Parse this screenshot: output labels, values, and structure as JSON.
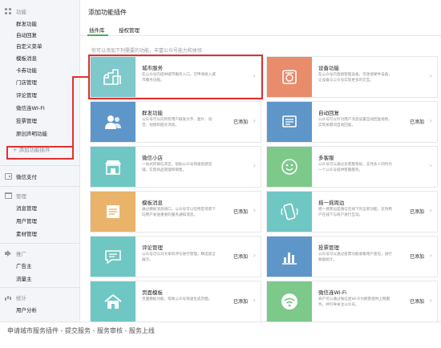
{
  "sidebar": {
    "sections": [
      {
        "title": "功能",
        "icon": "grid-icon",
        "items": [
          "群发功能",
          "自动回复",
          "自定义菜单",
          "模板消息",
          "卡券功能",
          "门店管理",
          "评论管理",
          "微信连WI-FI",
          "投票管理",
          "原创声明功能"
        ]
      },
      {
        "title": "微信支付",
        "icon": "wallet-icon",
        "items": []
      },
      {
        "title": "管理",
        "icon": "folder-icon",
        "items": [
          "消息管理",
          "用户管理",
          "素材管理"
        ]
      },
      {
        "title": "推广",
        "icon": "megaphone-icon",
        "items": [
          "广告主",
          "流量主"
        ]
      },
      {
        "title": "统计",
        "icon": "bar-chart-icon",
        "items": [
          "用户分析"
        ]
      }
    ],
    "add_plugin_label": "+ 添加功能插件"
  },
  "main": {
    "title": "添加功能插件",
    "tabs": [
      {
        "label": "插件库",
        "active": true
      },
      {
        "label": "授权管理",
        "active": false
      }
    ],
    "hint": "你可以添加下列需要的功能，丰富公众号能力和体验",
    "plugins": [
      {
        "name": "城市服务",
        "desc": "在公众号内提供城市服务入口，可申请接入城市服务功能。",
        "status": "",
        "color": "#7fc8cc",
        "icon": "city-icon",
        "highlight": true
      },
      {
        "name": "设备功能",
        "desc": "在公众号内直接管理设备，可连接硬件设备，让设备与公众号实现更多的交互。",
        "status": "",
        "color": "#e98c6c",
        "icon": "device-icon",
        "highlight": false
      },
      {
        "name": "群发功能",
        "desc": "公众号可以向所有用户群发文字、图片、语音、视频和图文消息。",
        "status": "已添加",
        "color": "#5f96c9",
        "icon": "users-icon",
        "highlight": false
      },
      {
        "name": "自动回复",
        "desc": "公众号可以针对用户消息设置自动回复规则，实现关键词自动回复。",
        "status": "已添加",
        "color": "#5f96c9",
        "icon": "reply-icon",
        "highlight": false
      },
      {
        "name": "微信小店",
        "desc": "一站式的微信开店，帮助公众号快速搭建店铺，实现商品管理和销售。",
        "status": "",
        "color": "#6fc7c4",
        "icon": "shop-icon",
        "highlight": false
      },
      {
        "name": "多客服",
        "desc": "公众号可以通过多客服系统，支持多人同时为一个公众号提供客服服务。",
        "status": "",
        "color": "#7cc98a",
        "icon": "service-icon",
        "highlight": false
      },
      {
        "name": "模板消息",
        "desc": "通过模板消息接口，公众号可以在特定场景下向用户发送重要的服务通知消息。",
        "status": "已添加",
        "color": "#e9b36a",
        "icon": "template-icon",
        "highlight": false
      },
      {
        "name": "摇一摇周边",
        "desc": "摇一摇周边是微信在线下的全新功能，支持用户在线下与商户进行互动。",
        "status": "已添加",
        "color": "#6fc7c4",
        "icon": "shake-icon",
        "highlight": false
      },
      {
        "name": "评论管理",
        "desc": "公众号可以对文章的评论进行管理，精选留言展示。",
        "status": "已添加",
        "color": "#6fc7c4",
        "icon": "comment-icon",
        "highlight": false
      },
      {
        "name": "投票管理",
        "desc": "公众号可以通过投票功能收集用户意见，进行数据统计。",
        "status": "已添加",
        "color": "#5f96c9",
        "icon": "vote-icon",
        "highlight": false
      },
      {
        "name": "页面模板",
        "desc": "页面模板功能，帮助公众号快速生成页面。",
        "status": "已添加",
        "color": "#6fc7c4",
        "icon": "home-icon",
        "highlight": false
      },
      {
        "name": "微信连Wi-Fi",
        "desc": "商户可以通过微信连Wi-Fi为顾客提供上网服务，并引导关注公众号。",
        "status": "已添加",
        "color": "#7cc98a",
        "icon": "wifi-icon",
        "highlight": false
      }
    ]
  },
  "caption": "申请城市服务插件 - 提交服务 - 服务审核 - 服务上线",
  "colors": {
    "accent": "#44b549",
    "highlight": "#e0312f",
    "sidebar_bg": "#f4f5f9"
  }
}
